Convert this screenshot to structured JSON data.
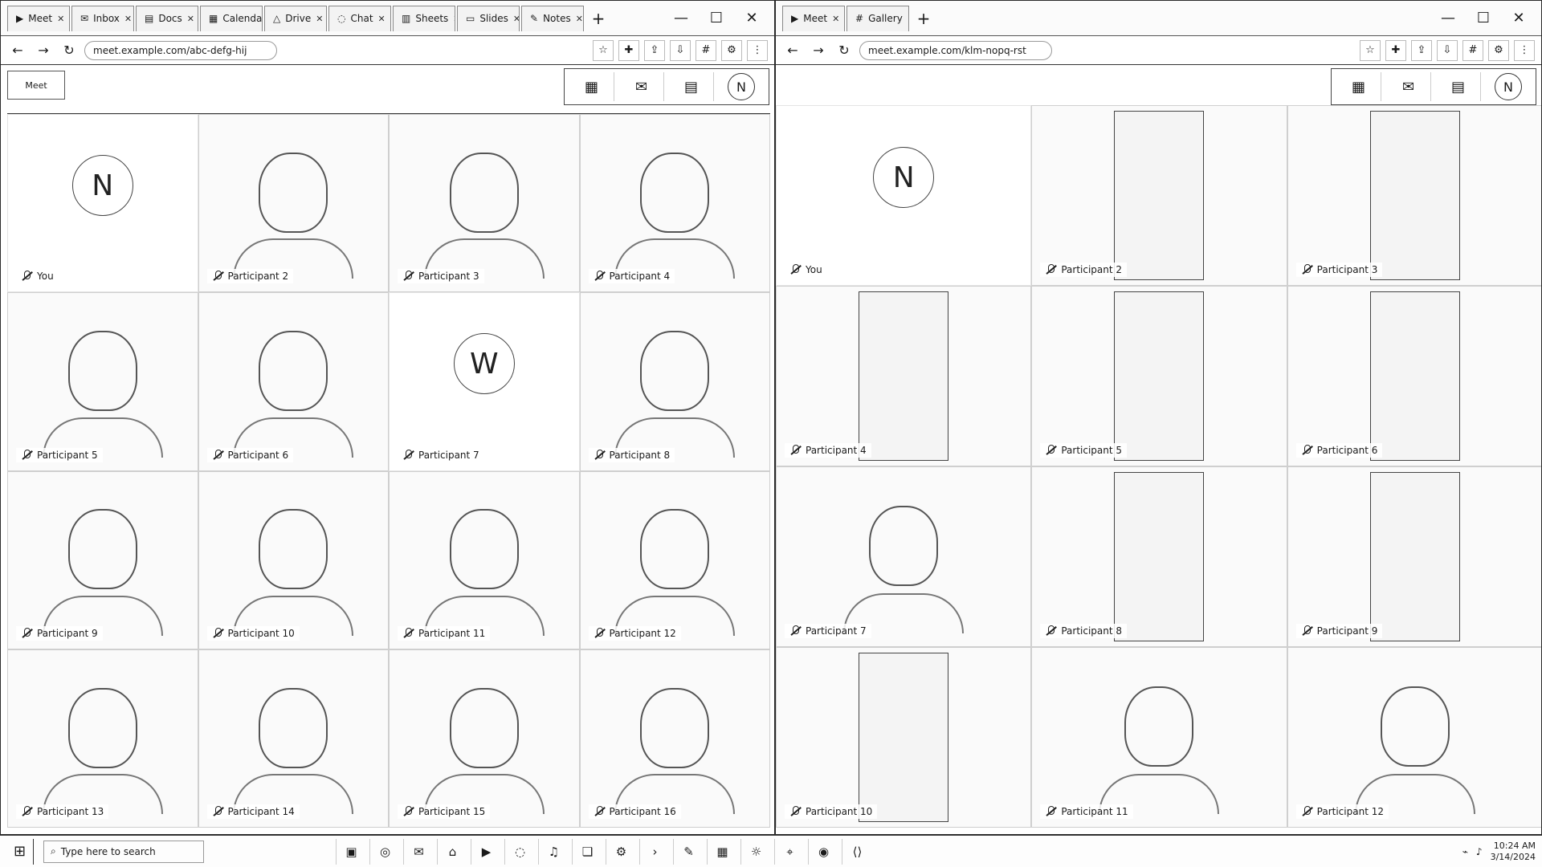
{
  "left_window": {
    "tabs": [
      {
        "label": "Meet",
        "icon": "video-icon"
      },
      {
        "label": "Inbox",
        "icon": "mail-icon"
      },
      {
        "label": "Docs",
        "icon": "doc-icon"
      },
      {
        "label": "Calendar",
        "icon": "calendar-icon"
      },
      {
        "label": "Drive",
        "icon": "drive-icon"
      },
      {
        "label": "Chat",
        "icon": "chat-icon"
      },
      {
        "label": "Sheets",
        "icon": "sheet-icon"
      },
      {
        "label": "Slides",
        "icon": "slides-icon"
      },
      {
        "label": "Notes",
        "icon": "note-icon"
      }
    ],
    "url": "meet.example.com/abc-defg-hij",
    "meet_logo": "Meet",
    "avatar_initial": "N",
    "tiles": [
      {
        "type": "avatar",
        "initial": "N",
        "name": "You"
      },
      {
        "type": "camera",
        "name": "Participant 2"
      },
      {
        "type": "camera",
        "name": "Participant 3"
      },
      {
        "type": "camera",
        "name": "Participant 4"
      },
      {
        "type": "camera",
        "name": "Participant 5"
      },
      {
        "type": "camera",
        "name": "Participant 6"
      },
      {
        "type": "avatar",
        "initial": "W",
        "name": "Participant 7"
      },
      {
        "type": "camera",
        "name": "Participant 8"
      },
      {
        "type": "camera",
        "name": "Participant 9"
      },
      {
        "type": "camera",
        "name": "Participant 10"
      },
      {
        "type": "camera",
        "name": "Participant 11"
      },
      {
        "type": "camera",
        "name": "Participant 12"
      },
      {
        "type": "camera",
        "name": "Participant 13"
      },
      {
        "type": "camera",
        "name": "Participant 14"
      },
      {
        "type": "camera",
        "name": "Participant 15"
      },
      {
        "type": "camera",
        "name": "Participant 16"
      }
    ]
  },
  "right_window": {
    "tabs": [
      {
        "label": "Meet",
        "icon": "video-icon"
      },
      {
        "label": "Gallery",
        "icon": "grid-icon"
      }
    ],
    "url": "meet.example.com/klm-nopq-rst",
    "avatar_initial": "N",
    "tiles": [
      {
        "type": "avatar",
        "initial": "N",
        "name": "You"
      },
      {
        "type": "portrait",
        "name": "Participant 2"
      },
      {
        "type": "portrait",
        "name": "Participant 3"
      },
      {
        "type": "portrait",
        "name": "Participant 4"
      },
      {
        "type": "portrait",
        "name": "Participant 5"
      },
      {
        "type": "portrait",
        "name": "Participant 6"
      },
      {
        "type": "camera",
        "name": "Participant 7"
      },
      {
        "type": "portrait",
        "name": "Participant 8"
      },
      {
        "type": "portrait",
        "name": "Participant 9"
      },
      {
        "type": "portrait",
        "name": "Participant 10"
      },
      {
        "type": "camera",
        "name": "Participant 11"
      },
      {
        "type": "camera",
        "name": "Participant 12"
      }
    ]
  },
  "taskbar": {
    "search_placeholder": "Type here to search",
    "apps": [
      "file-explorer-icon",
      "browser-icon",
      "mail-icon",
      "store-icon",
      "video-icon",
      "chat-icon",
      "music-icon",
      "photos-icon",
      "settings-icon",
      "terminal-icon",
      "notes-icon",
      "calendar-icon",
      "weather-icon",
      "maps-icon",
      "camera-icon",
      "code-icon"
    ],
    "time": "10:24 AM",
    "date": "3/14/2024"
  }
}
